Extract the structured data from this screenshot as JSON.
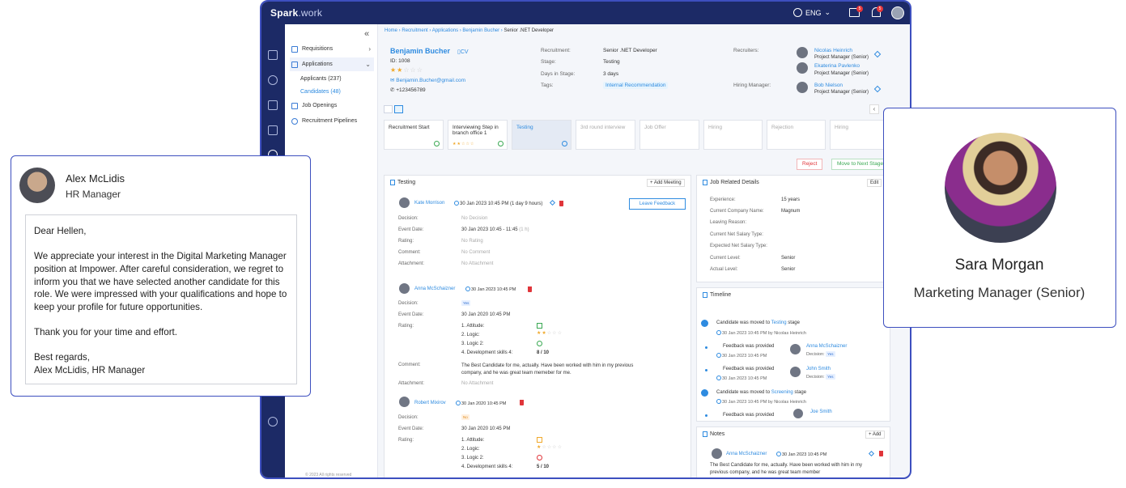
{
  "app": {
    "brand_main": "Spark",
    "brand_suffix": ".work",
    "language": "ENG",
    "mail_count": "5",
    "notif_count": "5"
  },
  "menu": {
    "requisitions": "Requisitions",
    "applications": "Applications",
    "applicants": "Applicants (237)",
    "candidates": "Candidates (48)",
    "job_openings": "Job Openings",
    "pipelines": "Recruitment Pipelines",
    "footer": "© 2023 All rights reserved"
  },
  "breadcrumb": [
    "Home",
    "Recruitment",
    "Applications",
    "Benjamin Bucher",
    "Senior .NET Developer"
  ],
  "candidate": {
    "name": "Benjamin Bucher",
    "cv": "CV",
    "id": "ID: 1008",
    "email": "Benjamin.Bucher@gmail.com",
    "phone": "+123456789",
    "rating": 2
  },
  "details": {
    "recruitment_label": "Recruitment:",
    "recruitment": "Senior .NET Developer",
    "stage_label": "Stage:",
    "stage": "Testing",
    "days_label": "Days in Stage:",
    "days": "3 days",
    "tags_label": "Tags:",
    "tag": "Internal Recommendation",
    "recruiters_label": "Recruiters:",
    "hiring_label": "Hiring Manager:",
    "recruiters": [
      {
        "name": "Nicolas Heinrich",
        "role": "Project Manager (Senior)"
      },
      {
        "name": "Ekaterina Pavlenko",
        "role": "Project Manager (Senior)"
      }
    ],
    "hiring_manager": {
      "name": "Bob Nielson",
      "role": "Project Manager (Senior)"
    }
  },
  "stages": [
    {
      "name": "Recruitment Start"
    },
    {
      "name": "Interviewing Step in branch office 1"
    },
    {
      "name": "Testing"
    },
    {
      "name": "3rd round interview"
    },
    {
      "name": "Job Offer"
    },
    {
      "name": "Hiring"
    },
    {
      "name": "Rejection"
    },
    {
      "name": "Hiring"
    }
  ],
  "actions": {
    "reject": "Reject",
    "next": "Move to Next Stage"
  },
  "testing": {
    "title": "Testing",
    "add_meeting": "+ Add Meeting",
    "leave_feedback": "Leave Feedback",
    "entry1": {
      "name": "Kate Morrison",
      "time": "30 Jan 2023 10:45 PM (1 day 9 hours)",
      "decision_l": "Decision:",
      "decision": "No Decision",
      "event_l": "Event Date:",
      "event": "30 Jan 2023 10:45 - 11:45",
      "dur": "(1 h)",
      "rating_l": "Rating:",
      "rating": "No Rating",
      "comment_l": "Comment:",
      "comment": "No Comment",
      "attach_l": "Attachment:",
      "attach": "No Attachment"
    },
    "entry2": {
      "name": "Anna McSchaizner",
      "time": "30 Jan 2023 10:45 PM",
      "decision_l": "Decision:",
      "decision": "Yes",
      "event_l": "Event Date:",
      "event": "30 Jan 2020 10:45 PM",
      "rating_l": "Rating:",
      "items": [
        "1. Attitude:",
        "2. Logic:",
        "3. Logic 2:",
        "4. Development skills 4:"
      ],
      "skills_score": "8 / 10",
      "comment_l": "Comment:",
      "comment": "The Best Candidate for me, actually. Have been worked with him  in my previous company, and he was great team memeber for me.",
      "attach_l": "Attachment:",
      "attach": "No Attachment"
    },
    "entry3": {
      "name": "Robert Mixirov",
      "time": "30 Jan 2020 10:45 PM",
      "decision_l": "Decision:",
      "decision": "No",
      "event_l": "Event Date:",
      "event": "30 Jan 2020 10:45 PM",
      "rating_l": "Rating:",
      "items": [
        "1. Attitude:",
        "2. Logic:",
        "3. Logic 2:",
        "4. Development skills 4:"
      ],
      "skills_score": "5 / 10"
    }
  },
  "job_details": {
    "title": "Job Related Details",
    "edit": "Edit",
    "rows": [
      {
        "label": "Experience:",
        "value": "15 years"
      },
      {
        "label": "Current Company Name:",
        "value": "Magnum"
      },
      {
        "label": "Leaving Reason:",
        "value": ""
      },
      {
        "label": "Current Net Salary Type:",
        "value": ""
      },
      {
        "label": "Expected Net Salary Type:",
        "value": ""
      },
      {
        "label": "Current Level:",
        "value": "Senior"
      },
      {
        "label": "Actual Level:",
        "value": "Senior"
      }
    ]
  },
  "timeline": {
    "title": "Timeline",
    "e1": {
      "pre": "Candidate was moved to",
      "stage": "Testing",
      "post": "stage",
      "meta": "30 Jan 2023 10:45 PM by Nicolas Heinrich"
    },
    "f1": {
      "text": "Feedback was provided",
      "time": "30 Jan 2023 10:45 PM",
      "who": "Anna McSchaizner",
      "dec": "Decision:",
      "val": "Yes"
    },
    "f2": {
      "text": "Feedback was provided",
      "time": "30 Jan 2023 10:45 PM",
      "who": "John Smith",
      "dec": "Decision:",
      "val": "Yes"
    },
    "e2": {
      "pre": "Candidate was moved to",
      "stage": "Screening",
      "post": "stage",
      "meta": "30 Jan 2023 10:45 PM by Nicolas Heinrich"
    },
    "f3": {
      "text": "Feedback was provided",
      "who": "Joe Smith"
    }
  },
  "notes": {
    "title": "Notes",
    "add": "+ Add",
    "who": "Anna McSchaizner",
    "time": "30 Jan 2023 10:45 PM",
    "text": "The Best Candidate for me, actually. Have been worked with him in my previous company, and he was great team member"
  },
  "email_card": {
    "name": "Alex McLidis",
    "role": "HR Manager",
    "greeting": "Dear Hellen,",
    "body": "We appreciate your interest in the Digital Marketing Manager position at Impower. After careful consideration, we regret to inform you that we have selected another candidate for this role. We were impressed with your qualifications and hope to keep your profile for future opportunities.",
    "thanks": "Thank you for your time and effort.",
    "closing": "Best regards,",
    "signature": "Alex McLidis, HR Manager"
  },
  "profile_card": {
    "name": "Sara Morgan",
    "role": "Marketing Manager (Senior)"
  }
}
